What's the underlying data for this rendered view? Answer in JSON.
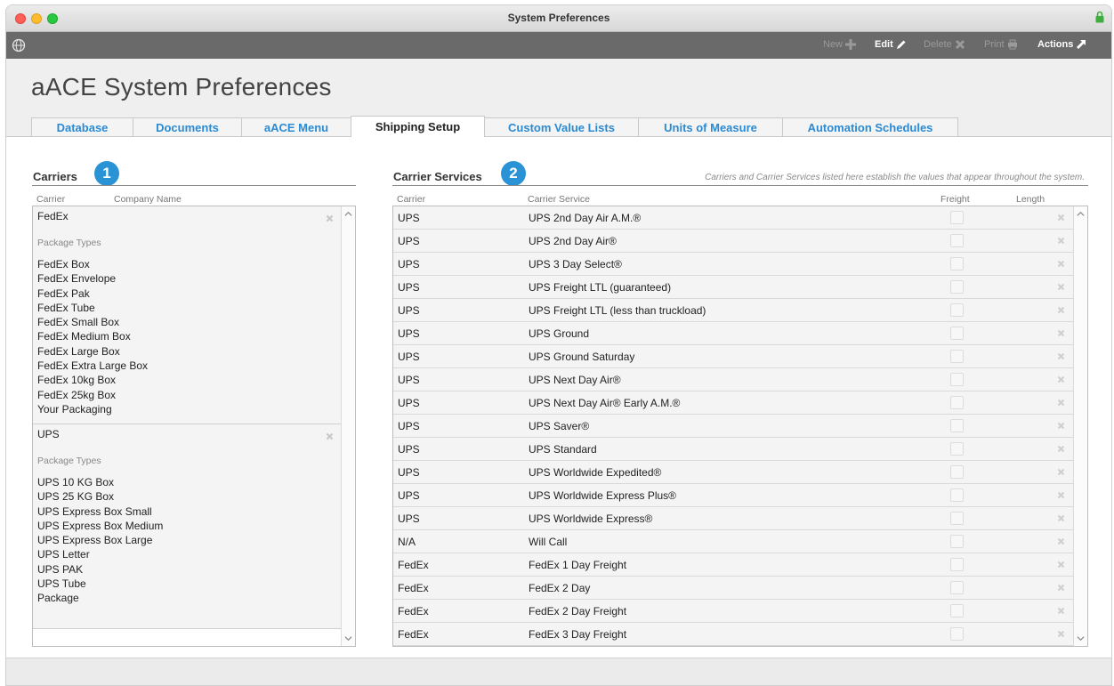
{
  "window": {
    "title": "System Preferences"
  },
  "toolbar": {
    "new_label": "New",
    "edit_label": "Edit",
    "delete_label": "Delete",
    "print_label": "Print",
    "actions_label": "Actions"
  },
  "header": {
    "title": "aACE System Preferences"
  },
  "tabs": [
    {
      "label": "Database"
    },
    {
      "label": "Documents"
    },
    {
      "label": "aACE Menu"
    },
    {
      "label": "Shipping Setup",
      "active": true
    },
    {
      "label": "Custom Value Lists"
    },
    {
      "label": "Units of Measure"
    },
    {
      "label": "Automation Schedules"
    }
  ],
  "carriers": {
    "title": "Carriers",
    "badge": "1",
    "col_carrier": "Carrier",
    "col_company": "Company Name",
    "items": [
      {
        "name": "FedEx",
        "package_label": "Package Types",
        "packages": [
          "FedEx Box",
          "FedEx Envelope",
          "FedEx Pak",
          "FedEx Tube",
          "FedEx Small Box",
          "FedEx Medium Box",
          "FedEx Large Box",
          "FedEx Extra Large Box",
          "FedEx 10kg Box",
          "FedEx 25kg Box",
          "Your Packaging"
        ]
      },
      {
        "name": "UPS",
        "package_label": "Package Types",
        "packages": [
          "UPS 10 KG Box",
          "UPS 25 KG Box",
          "UPS Express Box Small",
          "UPS Express Box Medium",
          "UPS Express Box Large",
          "UPS Letter",
          "UPS PAK",
          "UPS Tube",
          "Package"
        ]
      }
    ]
  },
  "services": {
    "title": "Carrier Services",
    "badge": "2",
    "note": "Carriers and Carrier Services listed here establish the values that appear throughout the system.",
    "col_carrier": "Carrier",
    "col_service": "Carrier Service",
    "col_freight": "Freight",
    "col_length": "Length",
    "rows": [
      {
        "carrier": "UPS",
        "service": "UPS 2nd Day Air A.M.®"
      },
      {
        "carrier": "UPS",
        "service": "UPS 2nd Day Air®"
      },
      {
        "carrier": "UPS",
        "service": "UPS 3 Day Select®"
      },
      {
        "carrier": "UPS",
        "service": "UPS Freight LTL (guaranteed)"
      },
      {
        "carrier": "UPS",
        "service": "UPS Freight LTL (less than truckload)"
      },
      {
        "carrier": "UPS",
        "service": "UPS Ground"
      },
      {
        "carrier": "UPS",
        "service": "UPS Ground Saturday"
      },
      {
        "carrier": "UPS",
        "service": "UPS Next Day Air®"
      },
      {
        "carrier": "UPS",
        "service": "UPS Next Day Air® Early A.M.®"
      },
      {
        "carrier": "UPS",
        "service": "UPS Saver®"
      },
      {
        "carrier": "UPS",
        "service": "UPS Standard"
      },
      {
        "carrier": "UPS",
        "service": "UPS Worldwide Expedited®"
      },
      {
        "carrier": "UPS",
        "service": "UPS Worldwide Express Plus®"
      },
      {
        "carrier": "UPS",
        "service": "UPS Worldwide Express®"
      },
      {
        "carrier": "N/A",
        "service": "Will Call"
      },
      {
        "carrier": "FedEx",
        "service": "FedEx 1 Day Freight"
      },
      {
        "carrier": "FedEx",
        "service": "FedEx 2 Day"
      },
      {
        "carrier": "FedEx",
        "service": "FedEx 2 Day Freight"
      },
      {
        "carrier": "FedEx",
        "service": "FedEx 3 Day Freight"
      }
    ]
  },
  "colors": {
    "accent": "#2a8ad4",
    "badge": "#2a93d5",
    "toolbar": "#6a6a6a",
    "lock": "#3fae3f"
  }
}
